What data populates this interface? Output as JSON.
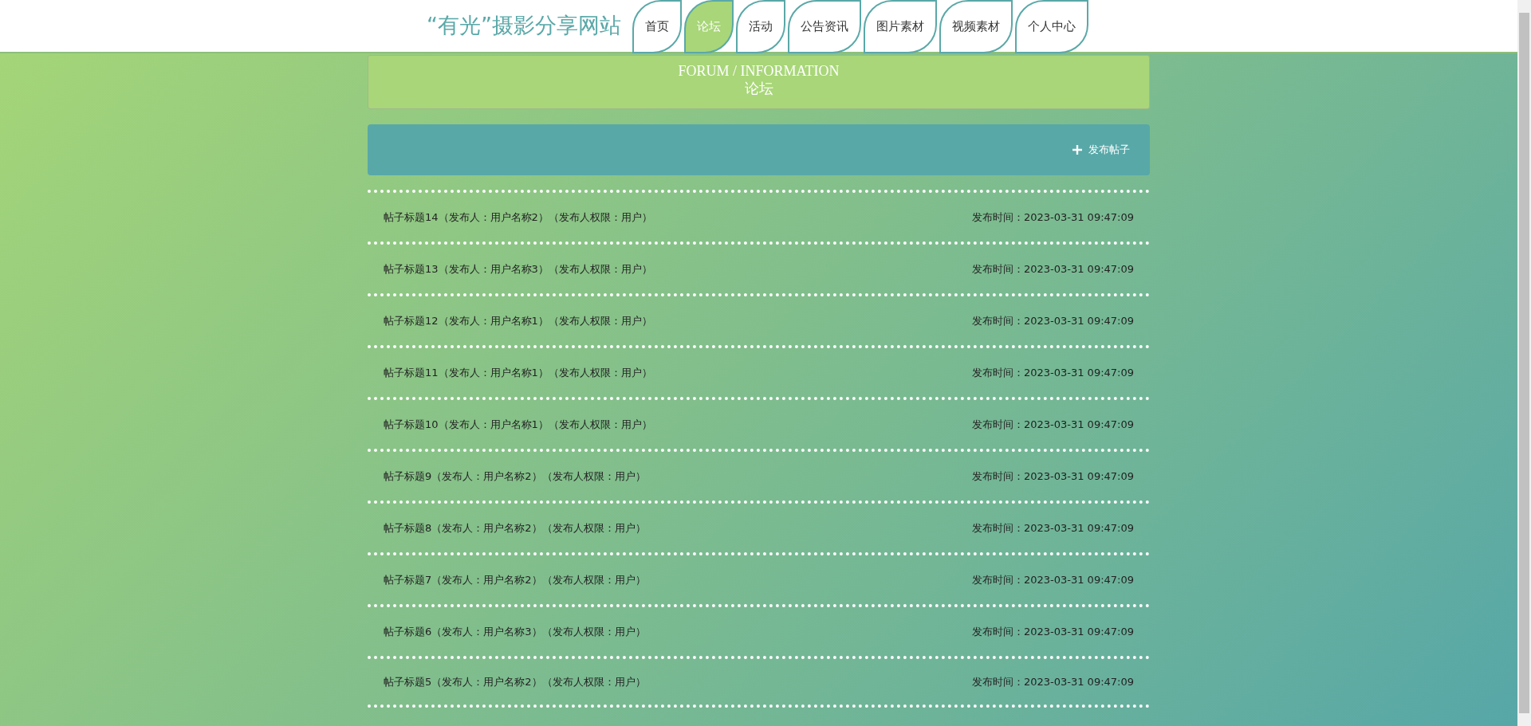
{
  "site_title": "“有光”摄影分享网站",
  "nav": [
    {
      "label": "首页",
      "selected": false
    },
    {
      "label": "论坛",
      "selected": true
    },
    {
      "label": "活动",
      "selected": false
    },
    {
      "label": "公告资讯",
      "selected": false
    },
    {
      "label": "图片素材",
      "selected": false
    },
    {
      "label": "视频素材",
      "selected": false
    },
    {
      "label": "个人中心",
      "selected": false
    }
  ],
  "banner": {
    "title_en": "FORUM / INFORMATION",
    "title_cn": "论坛"
  },
  "toolbar": {
    "add_button": "发布帖子"
  },
  "posts": [
    {
      "title": "帖子标题14（发布人：用户名称2）（发布人权限：用户）",
      "time": "发布时间：2023-03-31 09:47:09"
    },
    {
      "title": "帖子标题13（发布人：用户名称3）（发布人权限：用户）",
      "time": "发布时间：2023-03-31 09:47:09"
    },
    {
      "title": "帖子标题12（发布人：用户名称1）（发布人权限：用户）",
      "time": "发布时间：2023-03-31 09:47:09"
    },
    {
      "title": "帖子标题11（发布人：用户名称1）（发布人权限：用户）",
      "time": "发布时间：2023-03-31 09:47:09"
    },
    {
      "title": "帖子标题10（发布人：用户名称1）（发布人权限：用户）",
      "time": "发布时间：2023-03-31 09:47:09"
    },
    {
      "title": "帖子标题9（发布人：用户名称2）（发布人权限：用户）",
      "time": "发布时间：2023-03-31 09:47:09"
    },
    {
      "title": "帖子标题8（发布人：用户名称2）（发布人权限：用户）",
      "time": "发布时间：2023-03-31 09:47:09"
    },
    {
      "title": "帖子标题7（发布人：用户名称2）（发布人权限：用户）",
      "time": "发布时间：2023-03-31 09:47:09"
    },
    {
      "title": "帖子标题6（发布人：用户名称3）（发布人权限：用户）",
      "time": "发布时间：2023-03-31 09:47:09"
    },
    {
      "title": "帖子标题5（发布人：用户名称2）（发布人权限：用户）",
      "time": "发布时间：2023-03-31 09:47:09"
    }
  ]
}
